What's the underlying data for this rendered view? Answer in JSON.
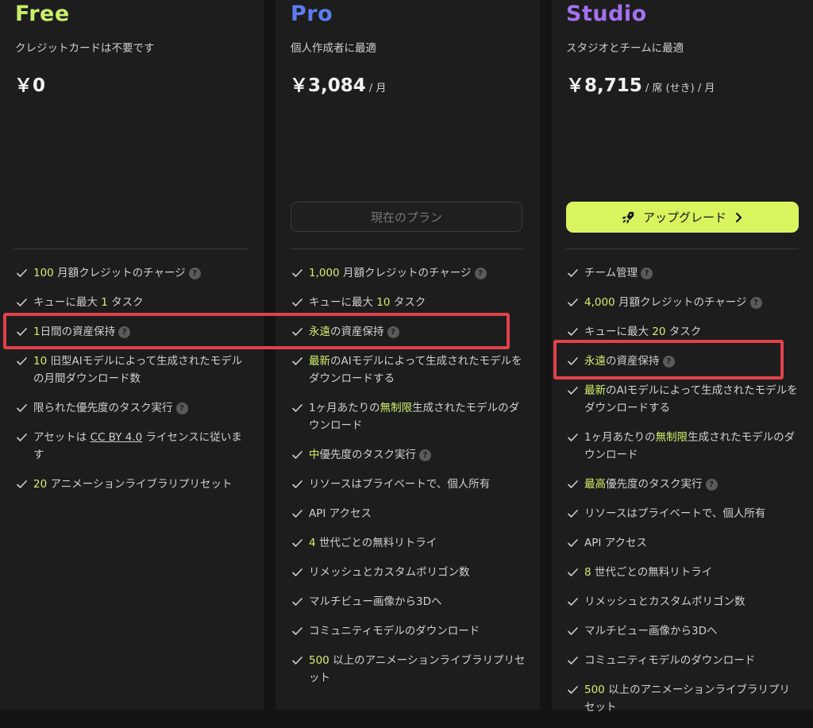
{
  "colors": {
    "free": "#c8ef6a",
    "pro": "#5c7cf0",
    "studio": "#a371f0",
    "highlight": "#d5ef6a",
    "annotation": "#e0424c"
  },
  "plans": {
    "free": {
      "name": "Free",
      "subtitle": "クレジットカードは不要です",
      "price": "￥0",
      "features": [
        {
          "parts": [
            {
              "t": "100",
              "hl": true
            },
            {
              "t": " 月額クレジットのチャージ"
            }
          ],
          "help": true
        },
        {
          "parts": [
            {
              "t": "キューに最大 "
            },
            {
              "t": "1",
              "hl": true
            },
            {
              "t": " タスク"
            }
          ],
          "help": false
        },
        {
          "parts": [
            {
              "t": "1",
              "hl": true
            },
            {
              "t": "日間の資産保持"
            }
          ],
          "help": true
        },
        {
          "parts": [
            {
              "t": "10",
              "hl": true
            },
            {
              "t": " 旧型AIモデルによって生成されたモデルの月間ダウンロード数"
            }
          ],
          "help": false
        },
        {
          "parts": [
            {
              "t": "限られた優先度のタスク実行"
            }
          ],
          "help": true
        },
        {
          "parts": [
            {
              "t": "アセットは "
            },
            {
              "t": "CC BY 4.0",
              "u": true
            },
            {
              "t": " ライセンスに従います"
            }
          ],
          "help": false
        },
        {
          "parts": [
            {
              "t": "20",
              "hl": true
            },
            {
              "t": " アニメーションライブラリプリセット"
            }
          ],
          "help": false
        }
      ]
    },
    "pro": {
      "name": "Pro",
      "subtitle": "個人作成者に最適",
      "price": "￥3,084",
      "per": " / 月",
      "button": "現在のプラン",
      "features": [
        {
          "parts": [
            {
              "t": "1,000",
              "hl": true
            },
            {
              "t": " 月額クレジットのチャージ"
            }
          ],
          "help": true
        },
        {
          "parts": [
            {
              "t": "キューに最大 "
            },
            {
              "t": "10",
              "hl": true
            },
            {
              "t": " タスク"
            }
          ],
          "help": false
        },
        {
          "parts": [
            {
              "t": "永遠",
              "hl": true
            },
            {
              "t": "の資産保持"
            }
          ],
          "help": true
        },
        {
          "parts": [
            {
              "t": "最新",
              "hl": true
            },
            {
              "t": "のAIモデルによって生成されたモデルをダウンロードする"
            }
          ],
          "help": false
        },
        {
          "parts": [
            {
              "t": "1ヶ月あたりの"
            },
            {
              "t": "無制限",
              "hl": true
            },
            {
              "t": "生成されたモデルのダウンロード"
            }
          ],
          "help": false
        },
        {
          "parts": [
            {
              "t": "中",
              "hl": true
            },
            {
              "t": "優先度のタスク実行"
            }
          ],
          "help": true
        },
        {
          "parts": [
            {
              "t": "リソースはプライベートで、個人所有"
            }
          ],
          "help": false
        },
        {
          "parts": [
            {
              "t": "API アクセス"
            }
          ],
          "help": false
        },
        {
          "parts": [
            {
              "t": "4",
              "hl": true
            },
            {
              "t": " 世代ごとの無料リトライ"
            }
          ],
          "help": false
        },
        {
          "parts": [
            {
              "t": "リメッシュとカスタムポリゴン数"
            }
          ],
          "help": false
        },
        {
          "parts": [
            {
              "t": "マルチビュー画像から3Dへ"
            }
          ],
          "help": false
        },
        {
          "parts": [
            {
              "t": "コミュニティモデルのダウンロード"
            }
          ],
          "help": false
        },
        {
          "parts": [
            {
              "t": "500",
              "hl": true
            },
            {
              "t": " 以上のアニメーションライブラリプリセット"
            }
          ],
          "help": false
        }
      ]
    },
    "studio": {
      "name": "Studio",
      "subtitle": "スタジオとチームに最適",
      "price": "￥8,715",
      "per": " / 席 (せき) / 月",
      "button": "アップグレード",
      "features": [
        {
          "parts": [
            {
              "t": "チーム管理"
            }
          ],
          "help": true
        },
        {
          "parts": [
            {
              "t": "4,000",
              "hl": true
            },
            {
              "t": " 月額クレジットのチャージ"
            }
          ],
          "help": true
        },
        {
          "parts": [
            {
              "t": "キューに最大 "
            },
            {
              "t": "20",
              "hl": true
            },
            {
              "t": " タスク"
            }
          ],
          "help": false
        },
        {
          "parts": [
            {
              "t": "永遠",
              "hl": true
            },
            {
              "t": "の資産保持"
            }
          ],
          "help": true
        },
        {
          "parts": [
            {
              "t": "最新",
              "hl": true
            },
            {
              "t": "のAIモデルによって生成されたモデルをダウンロードする"
            }
          ],
          "help": false
        },
        {
          "parts": [
            {
              "t": "1ヶ月あたりの"
            },
            {
              "t": "無制限",
              "hl": true
            },
            {
              "t": "生成されたモデルのダウンロード"
            }
          ],
          "help": false
        },
        {
          "parts": [
            {
              "t": "最高",
              "hl": true
            },
            {
              "t": "優先度のタスク実行"
            }
          ],
          "help": true
        },
        {
          "parts": [
            {
              "t": "リソースはプライベートで、個人所有"
            }
          ],
          "help": false
        },
        {
          "parts": [
            {
              "t": "API アクセス"
            }
          ],
          "help": false
        },
        {
          "parts": [
            {
              "t": "8",
              "hl": true
            },
            {
              "t": " 世代ごとの無料リトライ"
            }
          ],
          "help": false
        },
        {
          "parts": [
            {
              "t": "リメッシュとカスタムポリゴン数"
            }
          ],
          "help": false
        },
        {
          "parts": [
            {
              "t": "マルチビュー画像から3Dへ"
            }
          ],
          "help": false
        },
        {
          "parts": [
            {
              "t": "コミュニティモデルのダウンロード"
            }
          ],
          "help": false
        },
        {
          "parts": [
            {
              "t": "500",
              "hl": true
            },
            {
              "t": " 以上のアニメーションライブラリプリセット"
            }
          ],
          "help": false
        }
      ]
    }
  },
  "help_glyph": "?"
}
